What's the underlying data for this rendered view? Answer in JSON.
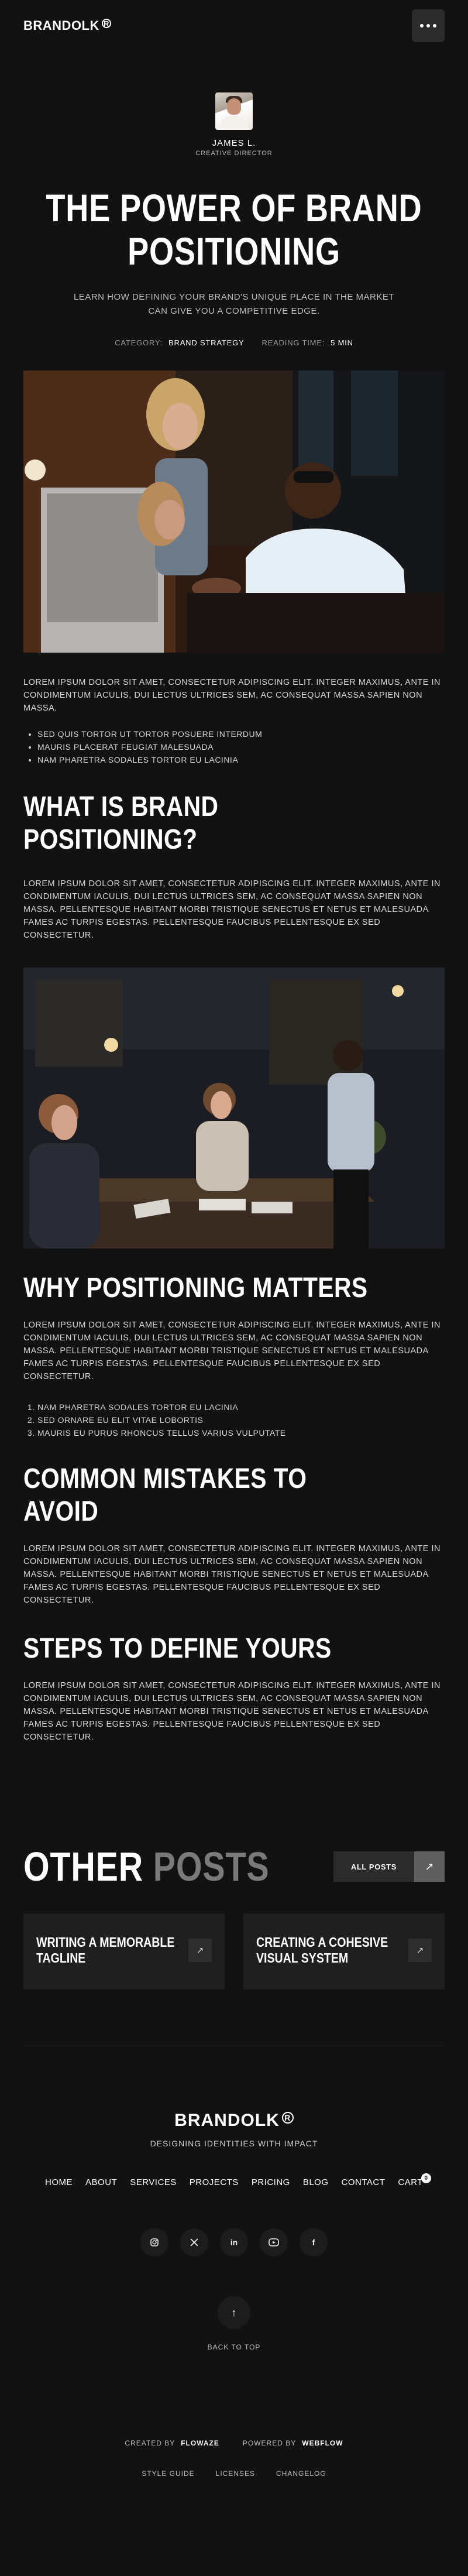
{
  "header": {
    "logo": "BRANDOLK",
    "logo_mark": "R",
    "menu_icon": "more-dots-icon"
  },
  "author": {
    "name": "JAMES L.",
    "role": "CREATIVE DIRECTOR"
  },
  "article": {
    "title_line1": "THE POWER OF BRAND",
    "title_line2": "POSITIONING",
    "lede": "LEARN HOW DEFINING YOUR BRAND'S UNIQUE PLACE IN THE MARKET CAN GIVE YOU A COMPETITIVE EDGE.",
    "category_label": "CATEGORY:",
    "category_value": "BRAND STRATEGY",
    "reading_label": "READING TIME:",
    "reading_value": "5 MIN",
    "intro_paragraph": "LOREM IPSUM DOLOR SIT AMET, CONSECTETUR ADIPISCING ELIT. INTEGER MAXIMUS, ANTE IN CONDIMENTUM IACULIS, DUI LECTUS ULTRICES SEM, AC CONSEQUAT MASSA SAPIEN NON MASSA.",
    "bullets": [
      "SED QUIS TORTOR UT TORTOR POSUERE INTERDUM",
      "MAURIS PLACERAT FEUGIAT MALESUADA",
      "NAM PHARETRA SODALES TORTOR EU LACINIA"
    ],
    "section1_heading": "WHAT IS BRAND POSITIONING?",
    "section1_paragraph": "LOREM IPSUM DOLOR SIT AMET, CONSECTETUR ADIPISCING ELIT. INTEGER MAXIMUS, ANTE IN CONDIMENTUM IACULIS, DUI LECTUS ULTRICES SEM, AC CONSEQUAT MASSA SAPIEN NON MASSA. PELLENTESQUE HABITANT MORBI TRISTIQUE SENECTUS ET NETUS ET MALESUADA FAMES AC TURPIS EGESTAS. PELLENTESQUE FAUCIBUS PELLENTESQUE EX SED CONSECTETUR.",
    "section2_heading": "WHY POSITIONING MATTERS",
    "section2_paragraph": "LOREM IPSUM DOLOR SIT AMET, CONSECTETUR ADIPISCING ELIT. INTEGER MAXIMUS, ANTE IN CONDIMENTUM IACULIS, DUI LECTUS ULTRICES SEM, AC CONSEQUAT MASSA SAPIEN NON MASSA. PELLENTESQUE HABITANT MORBI TRISTIQUE SENECTUS ET NETUS ET MALESUADA FAMES AC TURPIS EGESTAS. PELLENTESQUE FAUCIBUS PELLENTESQUE EX SED CONSECTETUR.",
    "numbered": [
      "NAM PHARETRA SODALES TORTOR EU LACINIA",
      "SED ORNARE EU ELIT VITAE LOBORTIS",
      "MAURIS EU PURUS RHONCUS TELLUS VARIUS VULPUTATE"
    ],
    "section3_heading": "COMMON MISTAKES TO AVOID",
    "section3_paragraph": "LOREM IPSUM DOLOR SIT AMET, CONSECTETUR ADIPISCING ELIT. INTEGER MAXIMUS, ANTE IN CONDIMENTUM IACULIS, DUI LECTUS ULTRICES SEM, AC CONSEQUAT MASSA SAPIEN NON MASSA. PELLENTESQUE HABITANT MORBI TRISTIQUE SENECTUS ET NETUS ET MALESUADA FAMES AC TURPIS EGESTAS. PELLENTESQUE FAUCIBUS PELLENTESQUE EX SED CONSECTETUR.",
    "section4_heading": "STEPS TO DEFINE YOURS",
    "section4_paragraph": "LOREM IPSUM DOLOR SIT AMET, CONSECTETUR ADIPISCING ELIT. INTEGER MAXIMUS, ANTE IN CONDIMENTUM IACULIS, DUI LECTUS ULTRICES SEM, AC CONSEQUAT MASSA SAPIEN NON MASSA. PELLENTESQUE HABITANT MORBI TRISTIQUE SENECTUS ET NETUS ET MALESUADA FAMES AC TURPIS EGESTAS. PELLENTESQUE FAUCIBUS PELLENTESQUE EX SED CONSECTETUR."
  },
  "other_posts": {
    "title_a": "OTHER",
    "title_b": "POSTS",
    "all_posts_label": "ALL POSTS",
    "cards": [
      {
        "title": "WRITING A MEMORABLE TAGLINE"
      },
      {
        "title": "CREATING A COHESIVE VISUAL SYSTEM"
      }
    ]
  },
  "footer": {
    "logo": "BRANDOLK",
    "logo_mark": "R",
    "tagline": "DESIGNING IDENTITIES WITH IMPACT",
    "nav": [
      "HOME",
      "ABOUT",
      "SERVICES",
      "PROJECTS",
      "PRICING",
      "BLOG",
      "CONTACT"
    ],
    "cart_label": "CART",
    "cart_count": "0",
    "social": [
      "instagram-icon",
      "x-icon",
      "linkedin-icon",
      "youtube-icon",
      "facebook-icon"
    ],
    "back_to_top": "BACK TO TOP",
    "created_by_label": "CREATED BY",
    "created_by_value": "FLOWAZE",
    "powered_by_label": "POWERED BY",
    "powered_by_value": "WEBFLOW",
    "legal": [
      "STYLE GUIDE",
      "LICENSES",
      "CHANGELOG"
    ]
  },
  "colors": {
    "background": "#121212",
    "card": "#1f1f1f",
    "text": "#e9e9e9",
    "muted": "#7a7a7a"
  }
}
